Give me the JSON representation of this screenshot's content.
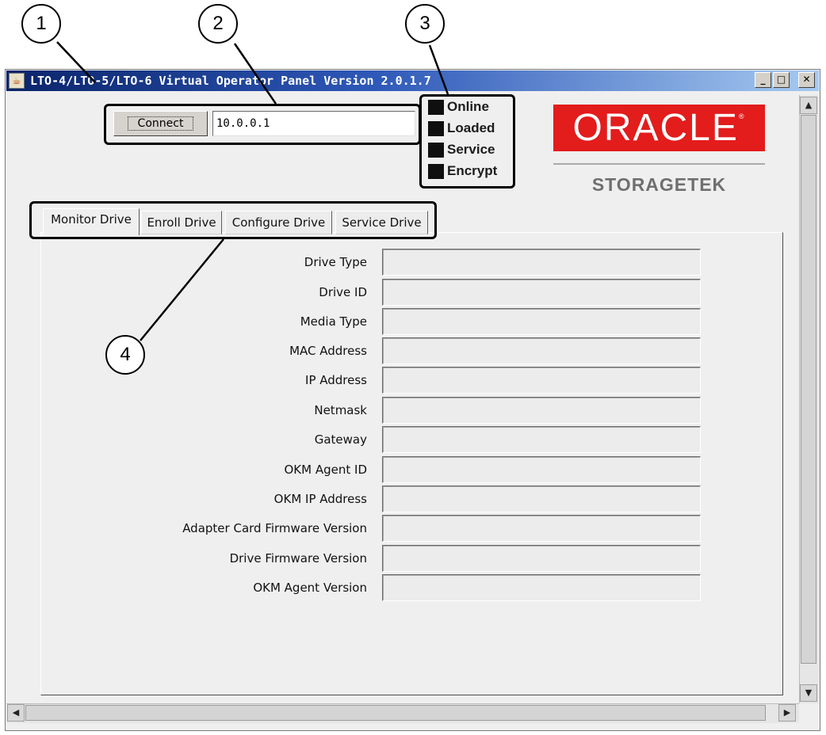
{
  "window": {
    "title": "LTO-4/LTO-5/LTO-6 Virtual Operator Panel Version 2.0.1.7",
    "controls": {
      "minimize": "_",
      "maximize": "□",
      "close": "✕"
    }
  },
  "connection": {
    "connect_label": "Connect",
    "ip_value": "10.0.0.1"
  },
  "indicators": [
    {
      "label": "Online"
    },
    {
      "label": "Loaded"
    },
    {
      "label": "Service"
    },
    {
      "label": "Encrypt"
    }
  ],
  "logo": {
    "brand": "ORACLE",
    "sub": "STORAGETEK",
    "brand_color": "#e31c1c"
  },
  "tabs": [
    {
      "label": "Monitor Drive",
      "active": true
    },
    {
      "label": "Enroll Drive",
      "active": false
    },
    {
      "label": "Configure Drive",
      "active": false
    },
    {
      "label": "Service Drive",
      "active": false
    }
  ],
  "monitor": {
    "fields": [
      {
        "label": "Drive Type",
        "value": ""
      },
      {
        "label": "Drive ID",
        "value": ""
      },
      {
        "label": "Media Type",
        "value": ""
      },
      {
        "label": "MAC Address",
        "value": ""
      },
      {
        "label": "IP Address",
        "value": ""
      },
      {
        "label": "Netmask",
        "value": ""
      },
      {
        "label": "Gateway",
        "value": ""
      },
      {
        "label": "OKM Agent ID",
        "value": ""
      },
      {
        "label": "OKM IP Address",
        "value": ""
      },
      {
        "label": "Adapter Card Firmware Version",
        "value": ""
      },
      {
        "label": "Drive Firmware Version",
        "value": ""
      },
      {
        "label": "OKM Agent Version",
        "value": ""
      }
    ]
  },
  "callouts": [
    "1",
    "2",
    "3",
    "4"
  ],
  "scroll": {
    "up_arrow": "▲",
    "down_arrow": "▼",
    "left_arrow": "◀",
    "right_arrow": "▶"
  }
}
